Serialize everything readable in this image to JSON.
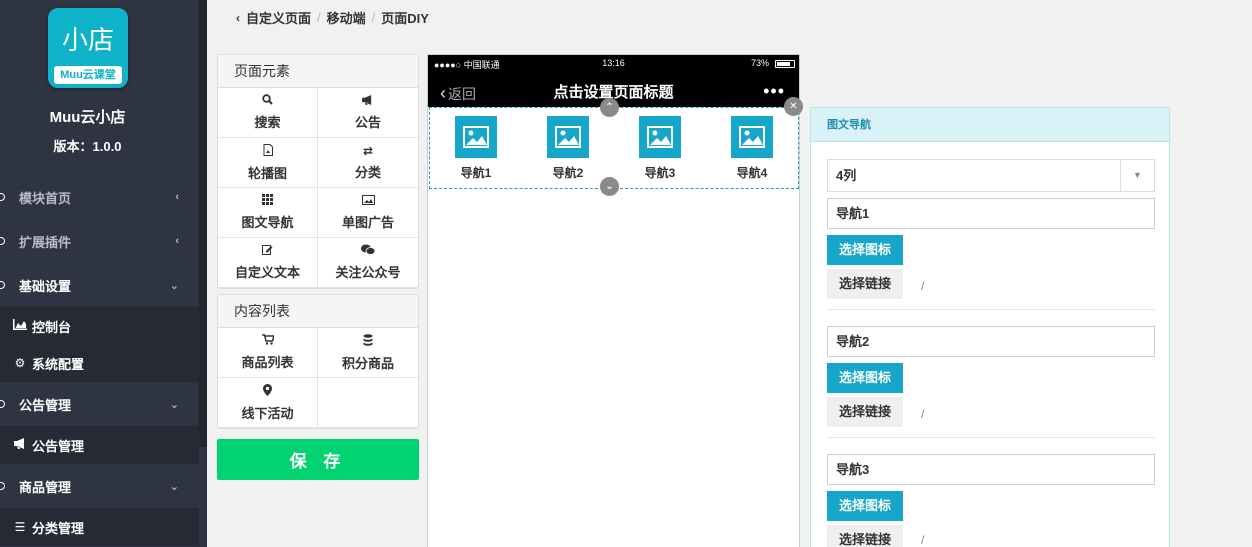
{
  "sidebar": {
    "logo_text": "小店",
    "logo_sub": "Muu云课堂",
    "app_name": "Muu云小店",
    "version": "版本：1.0.0",
    "menu": {
      "module_home": "模块首页",
      "ext_plugins": "扩展插件",
      "basic_settings": "基础设置",
      "console": "控制台",
      "system_config": "系统配置",
      "notice_mgmt": "公告管理",
      "notice_mgmt_sub": "公告管理",
      "goods_mgmt": "商品管理",
      "category_mgmt": "分类管理"
    }
  },
  "breadcrumb": {
    "item1": "自定义页面",
    "item2": "移动端",
    "item3": "页面DIY"
  },
  "elements_panel": {
    "title": "页面元素",
    "items": [
      "搜索",
      "公告",
      "轮播图",
      "分类",
      "图文导航",
      "单图广告",
      "自定义文本",
      "关注公众号"
    ]
  },
  "content_panel": {
    "title": "内容列表",
    "items": [
      "商品列表",
      "积分商品",
      "线下活动"
    ]
  },
  "save_label": "保 存",
  "phone": {
    "carrier": "●●●●○ 中国联通",
    "time": "13:16",
    "battery": "73%",
    "back_label": "返回",
    "title": "点击设置页面标题",
    "more": "•••",
    "nav": [
      "导航1",
      "导航2",
      "导航3",
      "导航4"
    ]
  },
  "settings": {
    "title": "图文导航",
    "columns_value": "4列",
    "nav_names": [
      "导航1",
      "导航2",
      "导航3"
    ],
    "choose_icon": "选择图标",
    "choose_link": "选择链接",
    "link_value": "/"
  },
  "colors": {
    "accent": "#16a6c9",
    "save_green": "#00d36f",
    "sidebar_bg": "#2f3442"
  }
}
